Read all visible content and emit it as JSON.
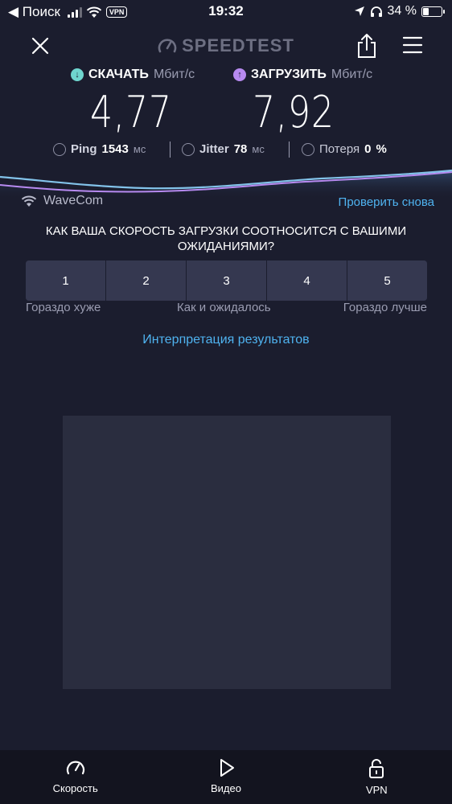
{
  "status_bar": {
    "back_label": "◀ Поиск",
    "vpn_badge": "VPN",
    "time": "19:32",
    "battery": "34 %"
  },
  "header": {
    "logo": "SPEEDTEST"
  },
  "download": {
    "title": "СКАЧАТЬ",
    "unit": "Мбит/с",
    "value": "4,77"
  },
  "upload": {
    "title": "ЗАГРУЗИТЬ",
    "unit": "Мбит/с",
    "value": "7,92"
  },
  "metrics": {
    "ping_label": "Ping",
    "ping_value": "1543",
    "ping_unit": "мс",
    "jitter_label": "Jitter",
    "jitter_value": "78",
    "jitter_unit": "мс",
    "loss_label": "Потеря",
    "loss_value": "0",
    "loss_unit": "%"
  },
  "network": {
    "name": "WaveCom",
    "retry_label": "Проверить снова"
  },
  "survey": {
    "question": "КАК ВАША СКОРОСТЬ ЗАГРУЗКИ СООТНОСИТСЯ С ВАШИМИ ОЖИДАНИЯМИ?",
    "options": [
      "1",
      "2",
      "3",
      "4",
      "5"
    ],
    "low_label": "Гораздо хуже",
    "mid_label": "Как и ожидалось",
    "high_label": "Гораздо лучше"
  },
  "interpretation_link": "Интерпретация результатов",
  "tabbar": {
    "items": [
      {
        "label": "Скорость",
        "icon": "speedometer-icon"
      },
      {
        "label": "Видео",
        "icon": "play-icon"
      },
      {
        "label": "VPN",
        "icon": "lock-icon"
      }
    ]
  },
  "colors": {
    "background": "#1b1d2e",
    "accent_blue": "#4fb3f0",
    "download_teal": "#6fd6cf",
    "upload_purple": "#b78af0"
  }
}
